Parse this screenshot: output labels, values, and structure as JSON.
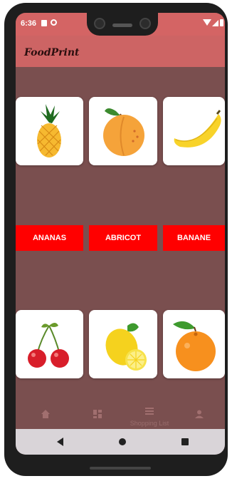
{
  "status_bar": {
    "time": "6:36"
  },
  "app_bar": {
    "title": "FoodPrint"
  },
  "fruits": [
    {
      "name": "ananas",
      "label": "ANANAS"
    },
    {
      "name": "abricot",
      "label": "ABRICOT"
    },
    {
      "name": "banane",
      "label": "BANANE"
    }
  ],
  "bottom_nav": {
    "items": [
      {
        "icon": "home-icon",
        "label": ""
      },
      {
        "icon": "dashboard-icon",
        "label": ""
      },
      {
        "icon": "list-icon",
        "label": "Shopping List"
      },
      {
        "icon": "person-icon",
        "label": ""
      }
    ]
  },
  "colors": {
    "background": "#7a4f4f",
    "app_bar": "#cd6464",
    "label": "#ff0000"
  }
}
